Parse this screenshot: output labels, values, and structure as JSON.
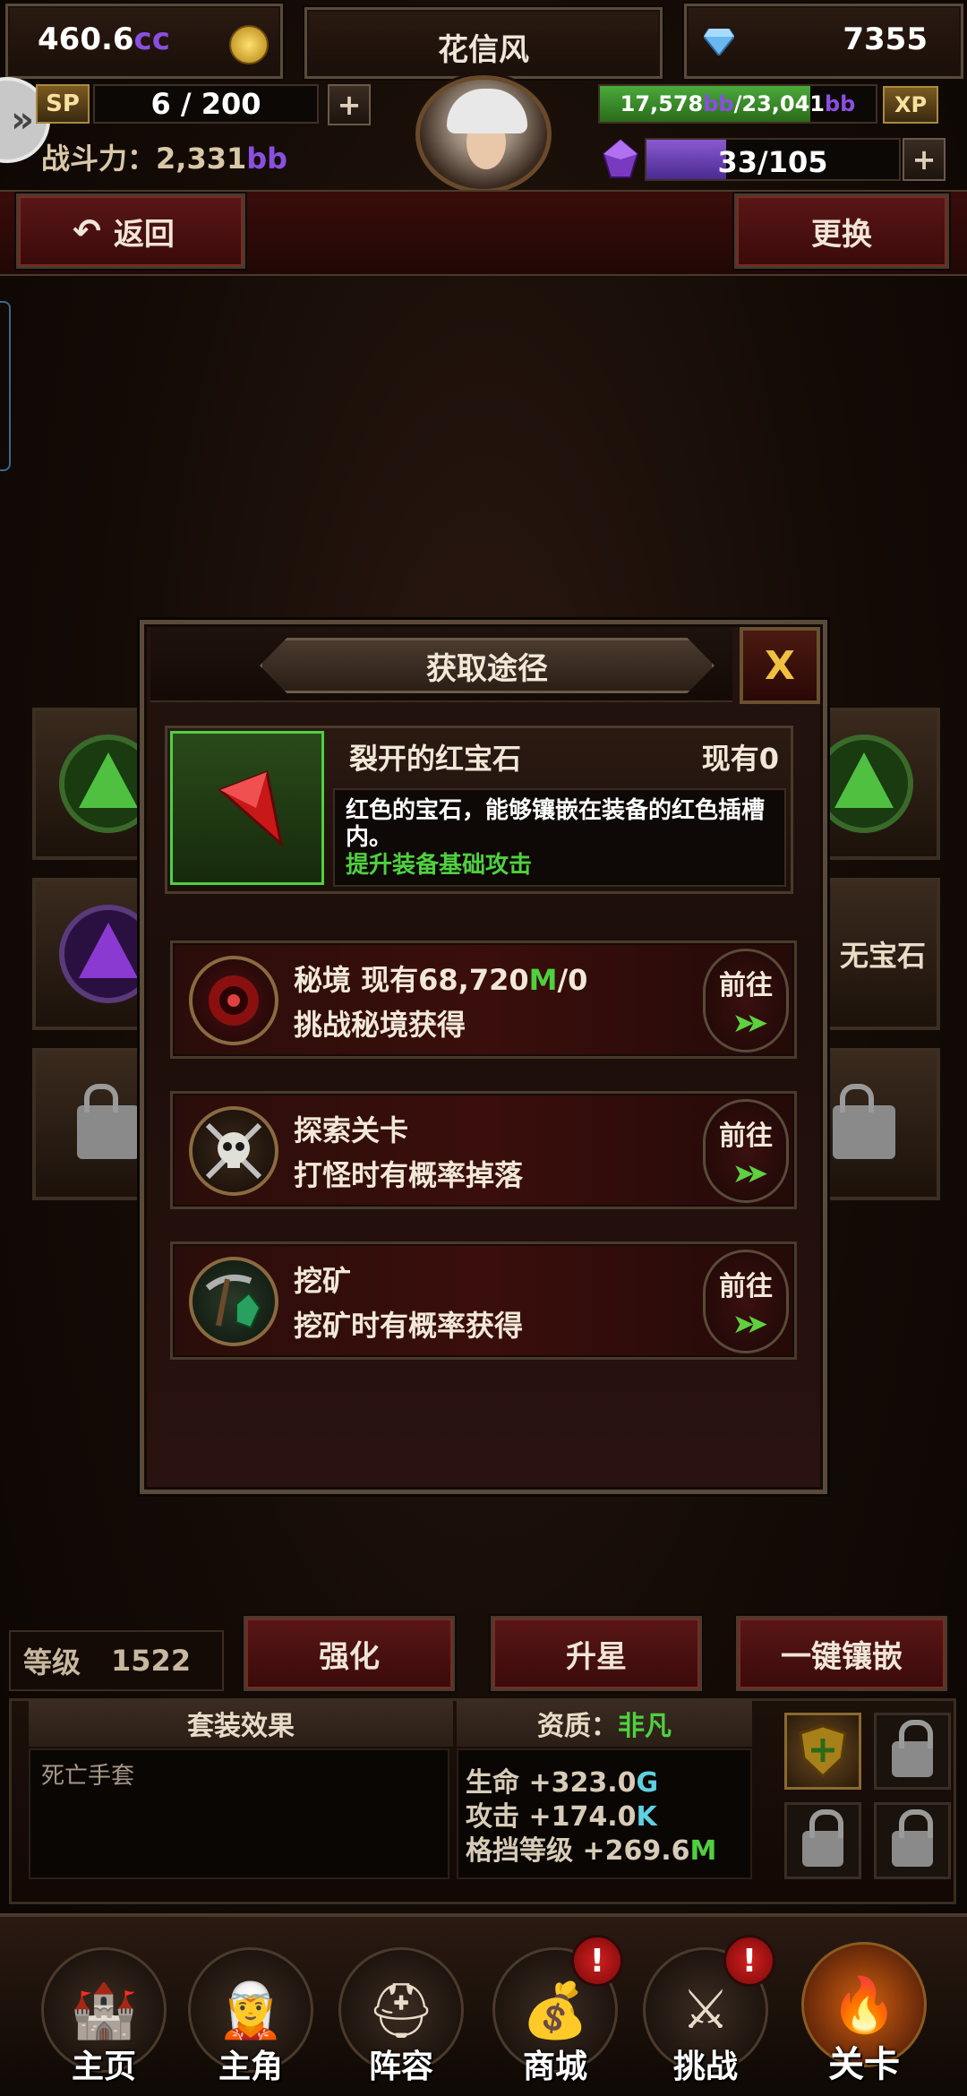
{
  "header": {
    "gold": "460.6",
    "gold_unit": "cc",
    "player_name": "花信风",
    "diamonds": "7355",
    "sp_label": "SP",
    "sp_value": "6 / 200",
    "power_label": "战斗力：",
    "power_value": "2,331",
    "power_unit": "bb",
    "xp_current": "17,578",
    "xp_unit1": "bb",
    "xp_max": "/23,041",
    "xp_unit2": "bb",
    "xp_label": "XP",
    "xp_fraction": 0.763,
    "energy_current": "33",
    "energy_max": "/105",
    "energy_fraction": 0.314,
    "plus": "+"
  },
  "nav": {
    "back_label": "返回",
    "swap_label": "更换"
  },
  "background_gems": {
    "right_label_partial": "无宝石"
  },
  "dialog": {
    "title": "获取途径",
    "close_label": "X",
    "item": {
      "name": "裂开的红宝石",
      "owned": "现有0",
      "description": "红色的宝石，能够镶嵌在装备的红色插槽内。",
      "effect": "提升装备基础攻击"
    },
    "routes": [
      {
        "title_prefix": "秘境 现有68,720",
        "title_unit": "M",
        "title_suffix": "/0",
        "subtitle": "挑战秘境获得",
        "go_label": "前往",
        "icon": "portal-icon"
      },
      {
        "title_prefix": "探索关卡",
        "title_unit": "",
        "title_suffix": "",
        "subtitle": "打怪时有概率掉落",
        "go_label": "前往",
        "icon": "skull-icon"
      },
      {
        "title_prefix": "挖矿",
        "title_unit": "",
        "title_suffix": "",
        "subtitle": "挖矿时有概率获得",
        "go_label": "前往",
        "icon": "pickaxe-icon"
      }
    ]
  },
  "bottom_panel": {
    "level_label": "等级",
    "level_value": "1522",
    "enhance_label": "强化",
    "star_label": "升星",
    "inlay_label": "一键镶嵌",
    "set_effect_label": "套装效果",
    "quality_label": "资质：",
    "quality_value": "非凡",
    "set_name": "死亡手套",
    "stats": [
      {
        "name": "生命",
        "value": "+323.0",
        "unit": "G"
      },
      {
        "name": "攻击",
        "value": "+174.0",
        "unit": "K"
      },
      {
        "name": "格挡等级",
        "value": "+269.6",
        "unit": "M"
      }
    ]
  },
  "tabbar": {
    "tabs": [
      {
        "label": "主页"
      },
      {
        "label": "主角"
      },
      {
        "label": "阵容"
      },
      {
        "label": "商城"
      },
      {
        "label": "挑战"
      },
      {
        "label": "关卡"
      }
    ],
    "alert_mark": "!"
  },
  "colors": {
    "accent_green": "#4fd040",
    "accent_purple": "#8a4fe0",
    "accent_cyan": "#5fd0e0",
    "xp_green": "#3a9a2a",
    "energy_purple": "#6a3ab0"
  }
}
